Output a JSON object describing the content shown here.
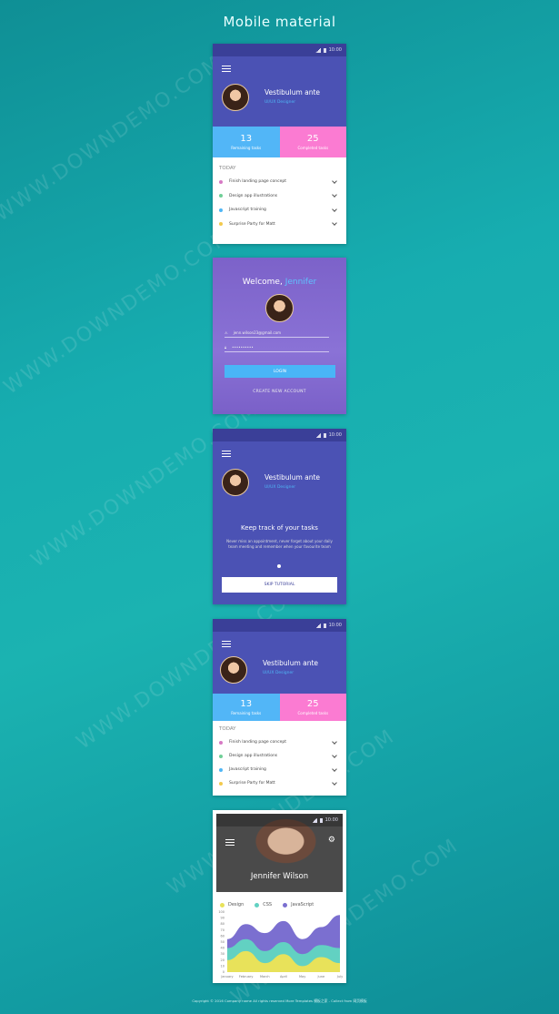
{
  "page": {
    "title": "Mobile material"
  },
  "status": {
    "time": "10:00"
  },
  "profile": {
    "name": "Vestibulum ante",
    "role": "UI/UX Designer"
  },
  "stats": [
    {
      "value": "13",
      "label": "Remaining tasks"
    },
    {
      "value": "25",
      "label": "Completed tasks"
    }
  ],
  "tasks": {
    "heading": "TODAY",
    "items": [
      {
        "label": "Finish landing page concept",
        "color": "#d679c4"
      },
      {
        "label": "Design app illustrations",
        "color": "#6fcf97"
      },
      {
        "label": "Javascript training",
        "color": "#4fb6f5"
      },
      {
        "label": "Surprise Party for Matt",
        "color": "#f2c94c"
      }
    ]
  },
  "login": {
    "welcome": "Welcome,",
    "user": "Jennifer",
    "email_value": "jenn.wilson23@gmail.com",
    "password_value": "••••••••••",
    "login_button": "LOGIN",
    "create_account": "CREATE NEW ACCOUNT"
  },
  "tutorial": {
    "title": "Keep track of your tasks",
    "body": "Never miss an appointment, never forget about your daily team meeting and remember when your favourite team",
    "skip_button": "SKIP TUTORIAL"
  },
  "profile2": {
    "name": "Jennifer Wilson"
  },
  "chart_data": {
    "type": "area",
    "categories": [
      "January",
      "February",
      "March",
      "April",
      "May",
      "June",
      "July"
    ],
    "ylim": [
      0,
      100
    ],
    "yticks": [
      0,
      10,
      20,
      30,
      40,
      50,
      60,
      70,
      80,
      90,
      100
    ],
    "series": [
      {
        "name": "Design",
        "color": "#e8e25a",
        "values": [
          20,
          35,
          15,
          30,
          10,
          25,
          15
        ]
      },
      {
        "name": "CSS",
        "color": "#62d1c2",
        "values": [
          40,
          55,
          35,
          50,
          30,
          45,
          40
        ]
      },
      {
        "name": "JavaScript",
        "color": "#7b6fd0",
        "values": [
          55,
          80,
          65,
          85,
          55,
          75,
          95
        ]
      }
    ]
  },
  "footer": {
    "text": "Copyright © 2016 Company name All rights reserved More Templates 模板之家 - Collect from 网页模板"
  },
  "watermark": {
    "text": "WWW.DOWNDEMO.COM"
  }
}
